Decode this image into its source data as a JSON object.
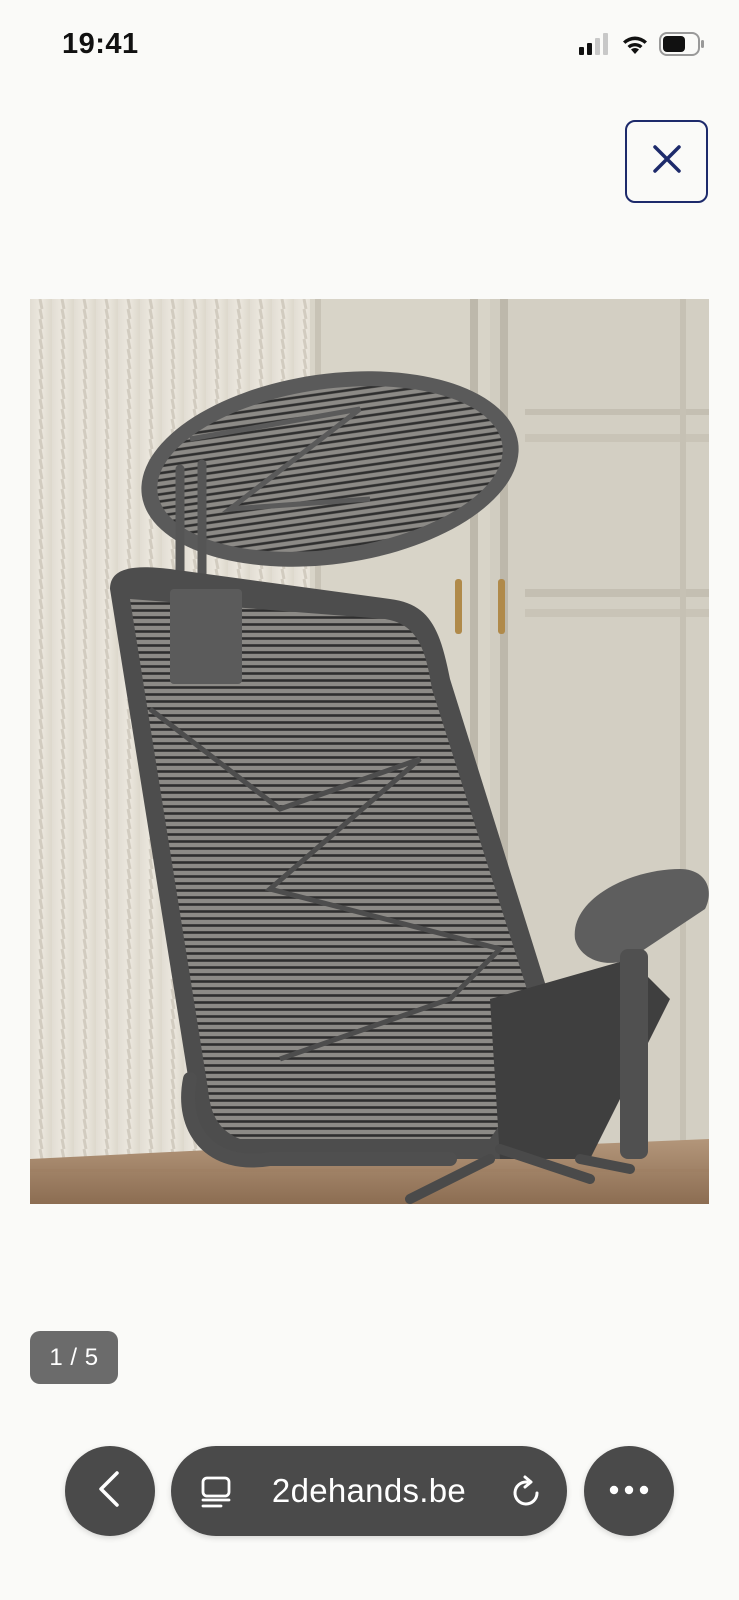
{
  "status_bar": {
    "time": "19:41",
    "icons": [
      "cellular-signal-icon",
      "wifi-icon",
      "battery-icon"
    ]
  },
  "close_button": {
    "icon": "close-icon",
    "color": "#1d2a6b"
  },
  "photo": {
    "counter": "1 / 5"
  },
  "browser_bar": {
    "back_icon": "chevron-left-icon",
    "reader_icon": "reader-mode-icon",
    "url": "2dehands.be",
    "reload_icon": "reload-icon",
    "more_icon": "more-icon",
    "bar_color": "#4a4a4a"
  }
}
